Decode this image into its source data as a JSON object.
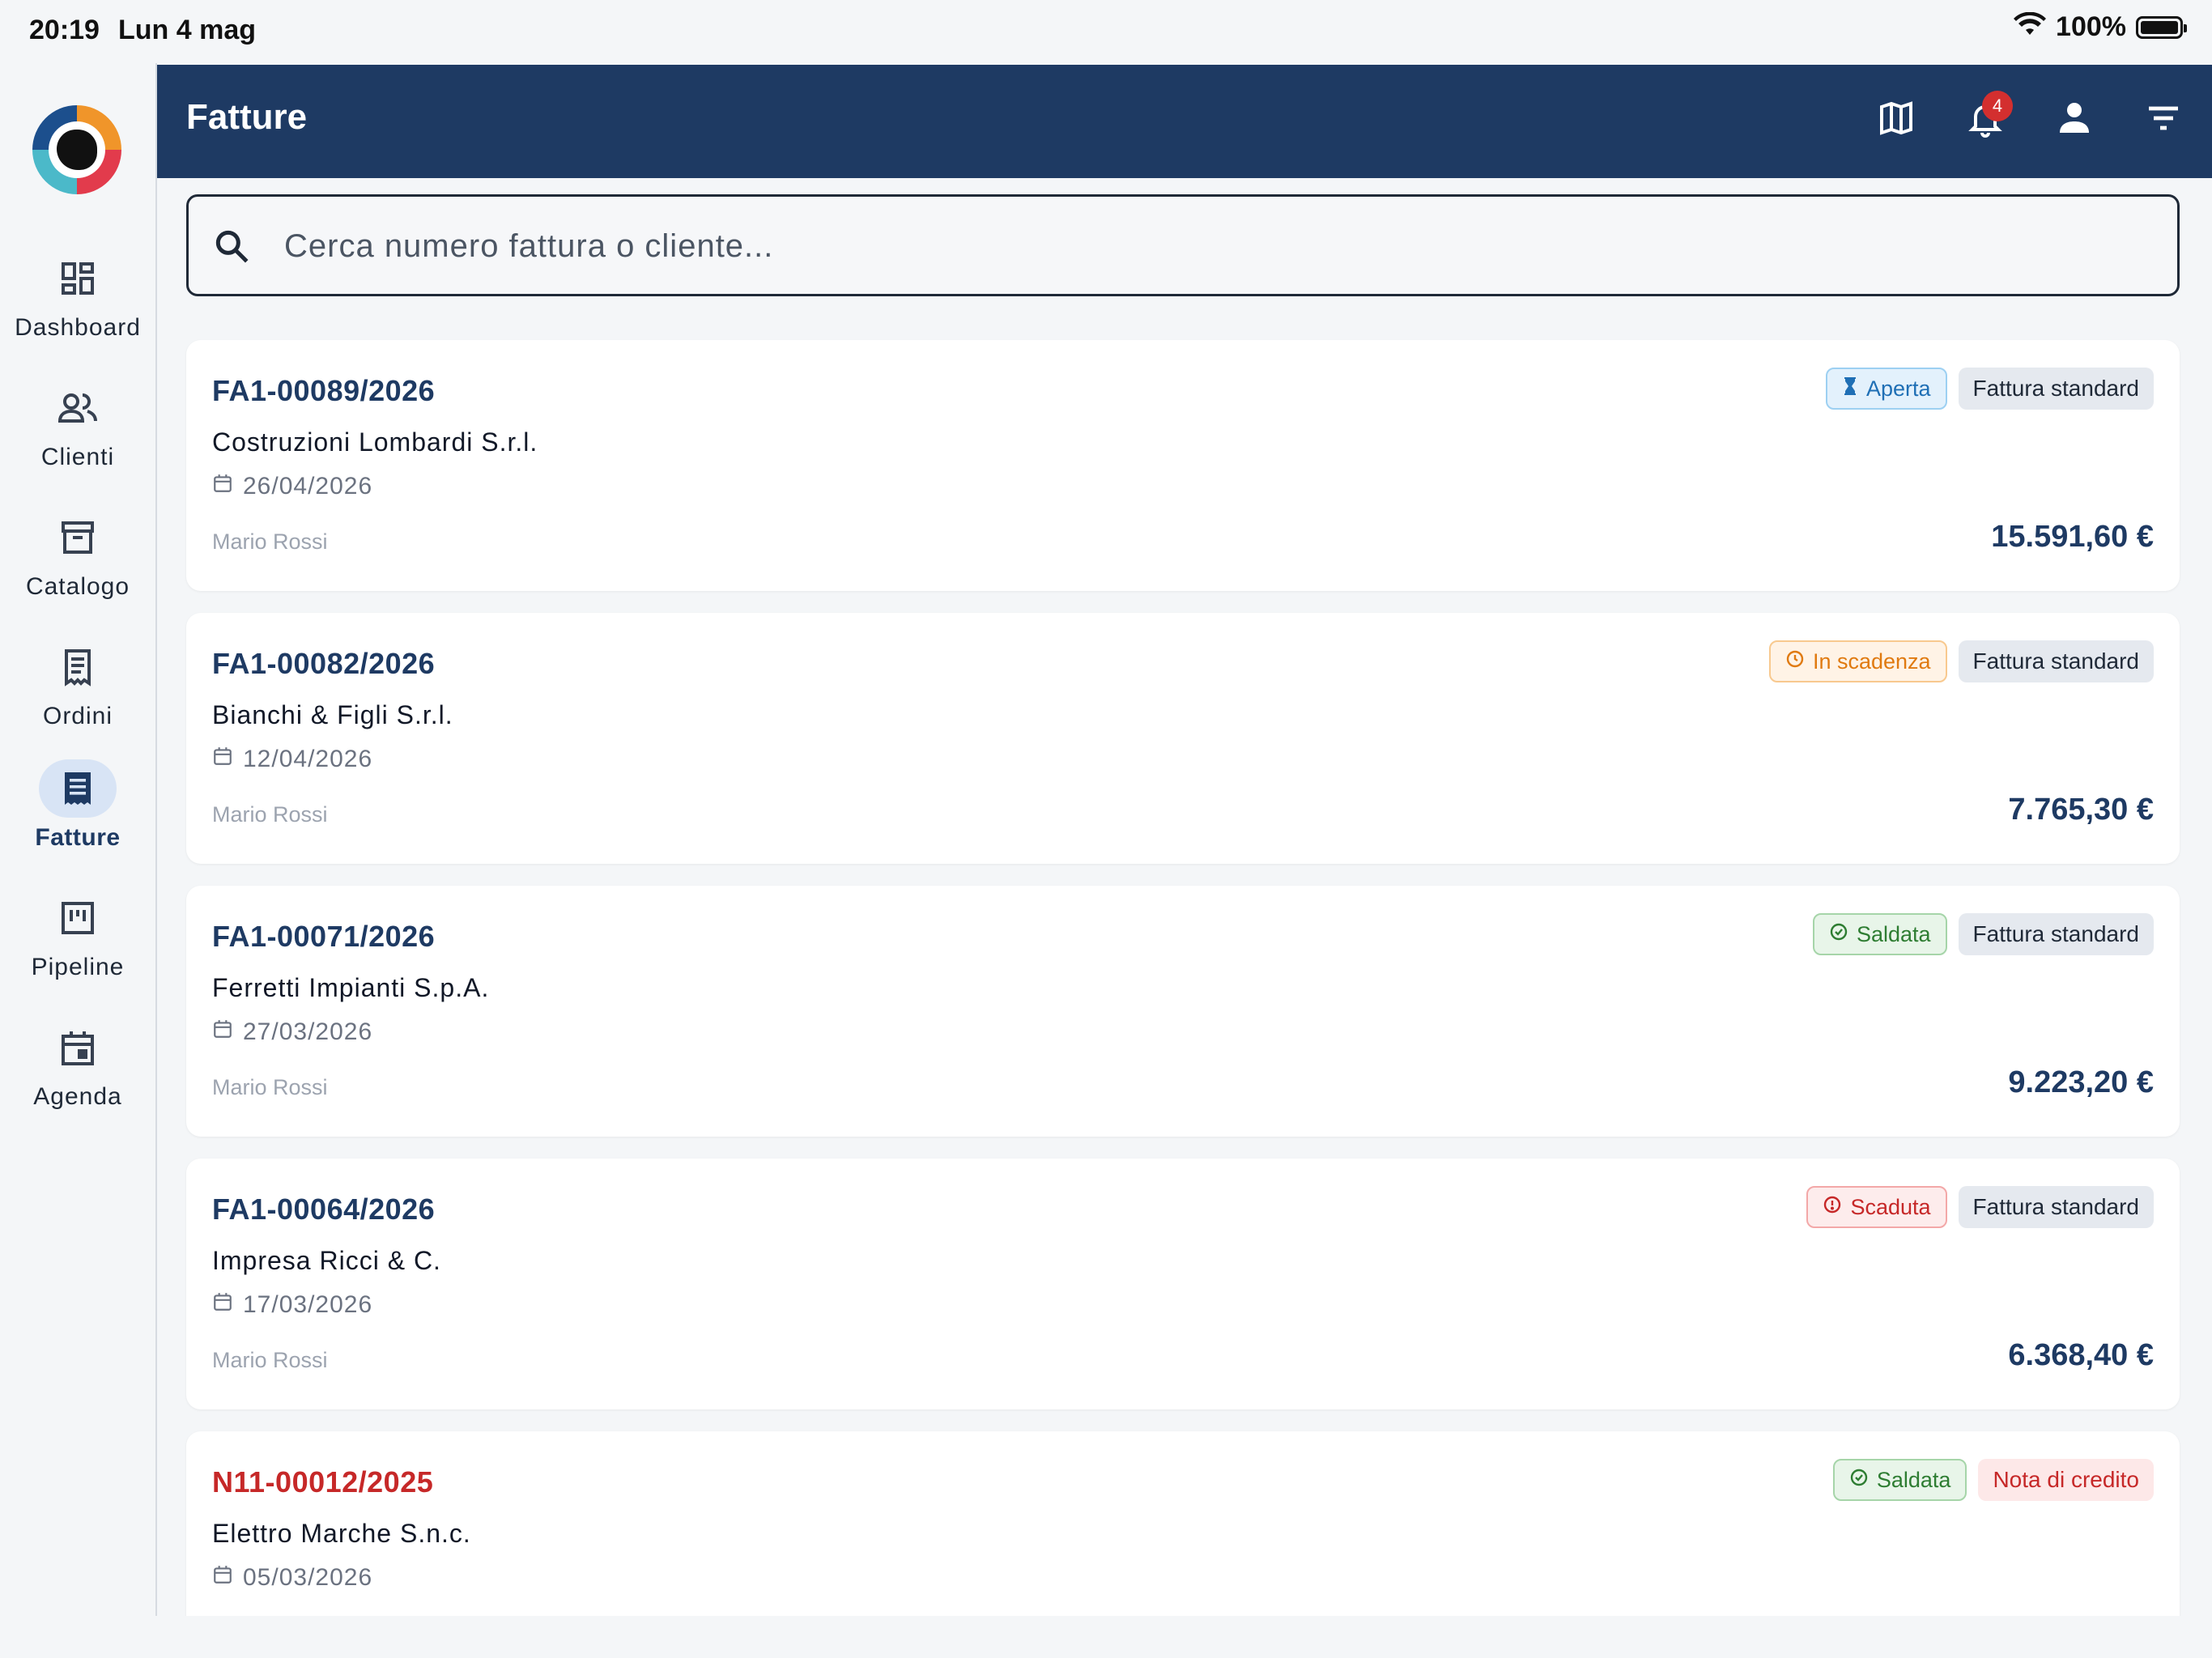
{
  "status_bar": {
    "time": "20:19",
    "date": "Lun 4 mag",
    "battery": "100%"
  },
  "nav": {
    "items": [
      {
        "label": "Dashboard",
        "icon": "dashboard-icon"
      },
      {
        "label": "Clienti",
        "icon": "people-icon"
      },
      {
        "label": "Catalogo",
        "icon": "archive-icon"
      },
      {
        "label": "Ordini",
        "icon": "receipt-icon"
      },
      {
        "label": "Fatture",
        "icon": "invoice-icon",
        "active": true
      },
      {
        "label": "Pipeline",
        "icon": "pipeline-icon"
      },
      {
        "label": "Agenda",
        "icon": "calendar-icon"
      }
    ]
  },
  "appbar": {
    "title": "Fatture",
    "notifications_count": "4",
    "actions": [
      "map-icon",
      "bell-icon",
      "person-icon",
      "filter-icon"
    ]
  },
  "search": {
    "placeholder": "Cerca numero fattura o cliente...",
    "value": ""
  },
  "invoices": [
    {
      "number": "FA1-00089/2026",
      "client": "Costruzioni Lombardi S.r.l.",
      "date": "26/04/2026",
      "agent": "Mario Rossi",
      "amount": "15.591,60 €",
      "status": "Aperta",
      "type": "Fattura standard"
    },
    {
      "number": "FA1-00082/2026",
      "client": "Bianchi & Figli S.r.l.",
      "date": "12/04/2026",
      "agent": "Mario Rossi",
      "amount": "7.765,30 €",
      "status": "In scadenza",
      "type": "Fattura standard"
    },
    {
      "number": "FA1-00071/2026",
      "client": "Ferretti Impianti S.p.A.",
      "date": "27/03/2026",
      "agent": "Mario Rossi",
      "amount": "9.223,20 €",
      "status": "Saldata",
      "type": "Fattura standard"
    },
    {
      "number": "FA1-00064/2026",
      "client": "Impresa Ricci & C.",
      "date": "17/03/2026",
      "agent": "Mario Rossi",
      "amount": "6.368,40 €",
      "status": "Scaduta",
      "type": "Fattura standard"
    },
    {
      "number": "N11-00012/2025",
      "client": "Elettro Marche S.n.c.",
      "date": "05/03/2026",
      "status": "Saldata",
      "type": "Nota di credito"
    }
  ],
  "colors": {
    "primary": "#1e3a63",
    "status_open": "#1f6fb5",
    "status_due": "#e07a10",
    "status_paid": "#2e7d32",
    "status_overdue": "#c62828"
  }
}
